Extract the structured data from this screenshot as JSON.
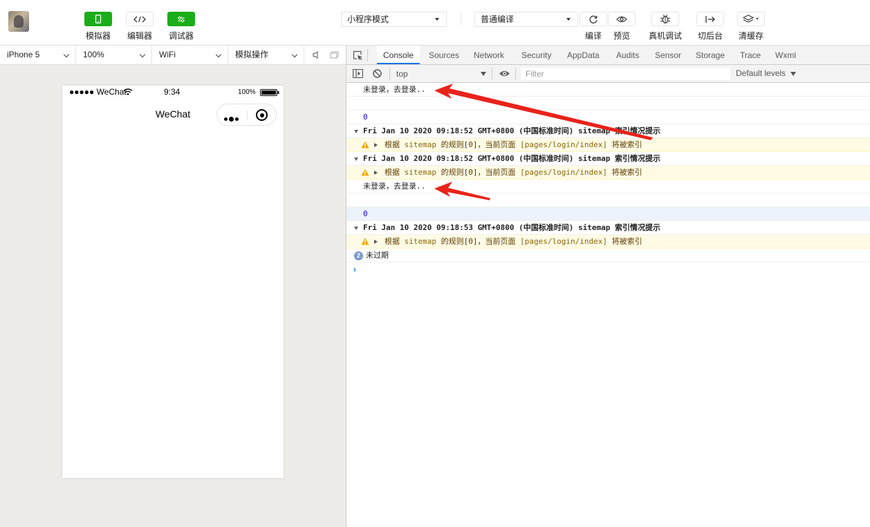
{
  "toolbar": {
    "simulator_label": "模拟器",
    "editor_label": "编辑器",
    "debugger_label": "调试器",
    "mode_select": "小程序模式",
    "compile_select": "普通编译",
    "compile_label": "编译",
    "preview_label": "预览",
    "remote_debug_label": "真机调试",
    "backend_label": "切后台",
    "clear_cache_label": "清缓存"
  },
  "devicebar": {
    "device": "iPhone 5",
    "zoom": "100%",
    "network": "WiFi",
    "operation": "模拟操作"
  },
  "phone": {
    "signal": "●●●●● WeChat",
    "time": "9:34",
    "battery": "100%",
    "nav_title": "WeChat"
  },
  "devtools": {
    "tabs": [
      "Console",
      "Sources",
      "Network",
      "Security",
      "AppData",
      "Audits",
      "Sensor",
      "Storage",
      "Trace",
      "Wxml"
    ],
    "context": "top",
    "filter_placeholder": "Filter",
    "levels": "Default levels"
  },
  "console": {
    "log1": "未登录，去登录..",
    "num1": "0",
    "group1": "Fri Jan 10 2020 09:18:52 GMT+0800 (中国标准时间) sitemap 索引情况提示",
    "warn1_a": "根据 ",
    "warn1_b": "sitemap",
    "warn1_c": " 的规则[0]，当前页面 ",
    "warn1_d": "[pages/login/index]",
    "warn1_e": " 将被索引",
    "group2": "Fri Jan 10 2020 09:18:52 GMT+0800 (中国标准时间) sitemap 索引情况提示",
    "log2": "未登录，去登录..",
    "num2": "0",
    "group3": "Fri Jan 10 2020 09:18:53 GMT+0800 (中国标准时间) sitemap 索引情况提示",
    "repeat_count": "2",
    "log3": "未过期",
    "prompt": "›"
  },
  "colors": {
    "green": "#1aad19",
    "arrow": "#e8231b",
    "active_tab": "#1a73e8"
  }
}
